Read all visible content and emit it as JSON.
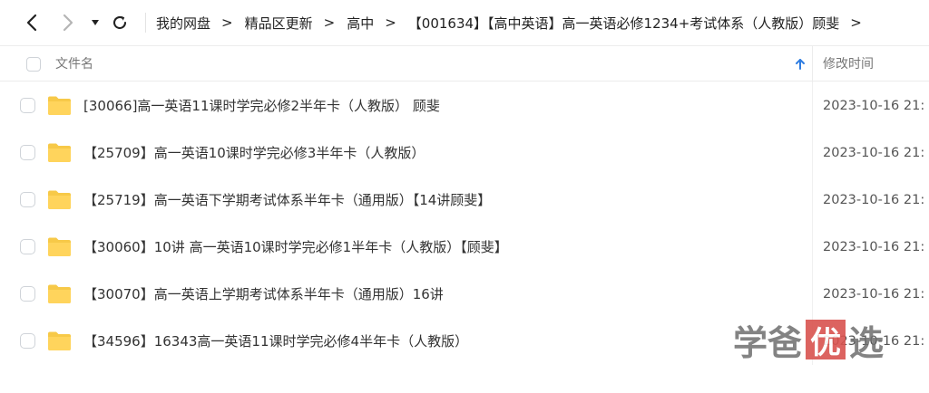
{
  "breadcrumb": {
    "items": [
      "我的网盘",
      "精品区更新",
      "高中",
      "【001634】【高中英语】高一英语必修1234+考试体系（人教版）顾斐"
    ],
    "separator": ">"
  },
  "table": {
    "header": {
      "name": "文件名",
      "modified": "修改时间"
    },
    "rows": [
      {
        "name": "[30066]高一英语11课时学完必修2半年卡（人教版） 顾斐",
        "modified": "2023-10-16 21:"
      },
      {
        "name": "【25709】高一英语10课时学完必修3半年卡（人教版）",
        "modified": "2023-10-16 21:"
      },
      {
        "name": "【25719】高一英语下学期考试体系半年卡（通用版）【14讲顾斐】",
        "modified": "2023-10-16 21:"
      },
      {
        "name": "【30060】10讲 高一英语10课时学完必修1半年卡（人教版）【顾斐】",
        "modified": "2023-10-16 21:"
      },
      {
        "name": "【30070】高一英语上学期考试体系半年卡（通用版）16讲",
        "modified": "2023-10-16 21:"
      },
      {
        "name": "【34596】16343高一英语11课时学完必修4半年卡（人教版）",
        "modified": "2023-10-16 21:"
      }
    ]
  },
  "watermark": {
    "chars": [
      "学",
      "爸",
      "优",
      "选"
    ]
  },
  "icons": {
    "back": "chevron-left-icon",
    "forward": "chevron-right-icon",
    "history": "caret-down-icon",
    "refresh": "refresh-icon",
    "sort": "arrow-up-icon",
    "folder": "folder-icon"
  },
  "colors": {
    "folder": "#F7C948",
    "sort_arrow": "#2f7de1",
    "watermark_box": "#d9534f"
  }
}
